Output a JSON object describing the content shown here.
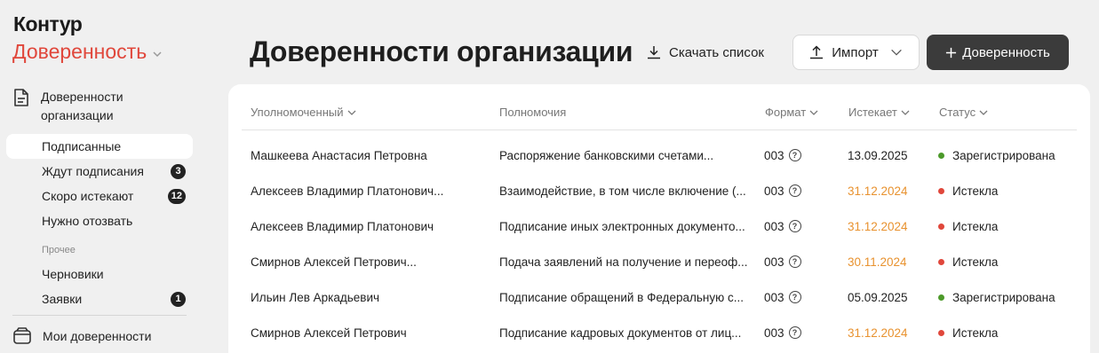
{
  "sidebar": {
    "logo": "Контур",
    "product": "Доверенность",
    "group_label": "Доверенности организации",
    "items": [
      {
        "label": "Подписанные",
        "badge": "",
        "active": true
      },
      {
        "label": "Ждут подписания",
        "badge": "3",
        "active": false
      },
      {
        "label": "Скоро истекают",
        "badge": "12",
        "active": false
      },
      {
        "label": "Нужно отозвать",
        "badge": "",
        "active": false
      }
    ],
    "other_caption": "Прочее",
    "other_items": [
      {
        "label": "Черновики",
        "badge": ""
      },
      {
        "label": "Заявки",
        "badge": "1"
      }
    ],
    "my_label": "Мои доверенности"
  },
  "header": {
    "title": "Доверенности организации",
    "download_label": "Скачать список",
    "import_label": "Импорт",
    "new_label": "Доверенность"
  },
  "table": {
    "columns": {
      "name": "Уполномоченный",
      "powers": "Полномочия",
      "format": "Формат",
      "expires": "Истекает",
      "status": "Статус"
    },
    "rows": [
      {
        "name": "Машкеева Анастасия Петровна",
        "powers": "Распоряжение банковскими счетами...",
        "format": "003",
        "expires": "13.09.2025",
        "expires_color": "#222222",
        "status": "Зарегистрирована",
        "status_color": "#4c9a2a"
      },
      {
        "name": "Алексеев Владимир Платонович...",
        "powers": "Взаимодействие, в том числе включение (...",
        "format": "003",
        "expires": "31.12.2024",
        "expires_color": "#e8922f",
        "status": "Истекла",
        "status_color": "#e0473b"
      },
      {
        "name": "Алексеев Владимир Платонович",
        "powers": "Подписание иных электронных документо...",
        "format": "003",
        "expires": "31.12.2024",
        "expires_color": "#e8922f",
        "status": "Истекла",
        "status_color": "#e0473b"
      },
      {
        "name": "Смирнов Алексей Петрович...",
        "powers": "Подача заявлений на получение и переоф...",
        "format": "003",
        "expires": "30.11.2024",
        "expires_color": "#e8922f",
        "status": "Истекла",
        "status_color": "#e0473b"
      },
      {
        "name": "Ильин Лев Аркадьевич",
        "powers": "Подписание обращений в Федеральную с...",
        "format": "003",
        "expires": "05.09.2025",
        "expires_color": "#222222",
        "status": "Зарегистрирована",
        "status_color": "#4c9a2a"
      },
      {
        "name": "Смирнов Алексей Петрович",
        "powers": "Подписание кадровых документов от лиц...",
        "format": "003",
        "expires": "31.12.2024",
        "expires_color": "#e8922f",
        "status": "Истекла",
        "status_color": "#e0473b"
      }
    ]
  }
}
